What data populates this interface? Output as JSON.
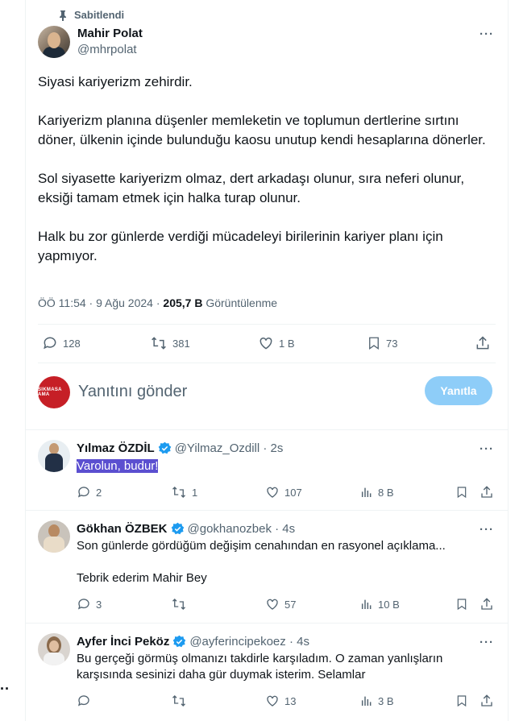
{
  "pinned_label": "Sabitlendi",
  "main_tweet": {
    "author": "Mahir Polat",
    "handle": "@mhrpolat",
    "paragraphs": [
      "Siyasi kariyerizm zehirdir.",
      "Kariyerizm planına düşenler memleketin ve toplumun dertlerine sırtını döner, ülkenin içinde bulunduğu kaosu unutup kendi hesaplarına dönerler.",
      "Sol siyasette kariyerizm olmaz, dert arkadaşı olunur, sıra neferi olunur, eksiği tamam etmek için halka turap olunur.",
      "Halk bu zor günlerde verdiği mücadeleyi birilerinin kariyer planı için yapmıyor."
    ],
    "time": "ÖÖ 11:54 · 9 Ağu 2024 · ",
    "views": "205,7 B",
    "views_label": " Görüntülenme",
    "replies": "128",
    "retweets": "381",
    "likes": "1 B",
    "bookmarks": "73"
  },
  "reply_box": {
    "avatar_text": "SIKMASA AMA",
    "placeholder": "Yanıtını gönder",
    "button": "Yanıtla"
  },
  "replies": [
    {
      "name": "Yılmaz ÖZDİL",
      "handle": "@Yilmaz_Ozdill · 2s",
      "lines": [
        "Varolun, budur!"
      ],
      "replies": "2",
      "retweets": "1",
      "likes": "107",
      "views": "8 B"
    },
    {
      "name": "Gökhan ÖZBEK",
      "handle": "@gokhanozbek · 4s",
      "lines": [
        "Son günlerde gördüğüm değişim cenahından en rasyonel açıklama...",
        "Tebrik ederim Mahir Bey"
      ],
      "replies": "3",
      "retweets": "",
      "likes": "57",
      "views": "10 B"
    },
    {
      "name": "Ayfer İnci Peköz",
      "handle": "@ayferincipekoez · 4s",
      "lines": [
        "Bu gerçeği görmüş olmanızı takdirle karşıladım. O zaman yanlışların",
        "karşısında sesinizi daha gür duymak isterim. Selamlar"
      ],
      "replies": "",
      "retweets": "",
      "likes": "13",
      "views": "3 B"
    }
  ],
  "colors": {
    "text": "#0f1419",
    "muted": "#536471",
    "border": "#eff3f4",
    "accent": "#1d9bf0",
    "reply_button": "#8ecdf8",
    "selection": "#5b4fd0"
  },
  "icons": [
    "pin-icon",
    "more-icon",
    "reply-icon",
    "retweet-icon",
    "like-icon",
    "bookmark-icon",
    "share-icon",
    "views-icon",
    "verified-icon"
  ]
}
